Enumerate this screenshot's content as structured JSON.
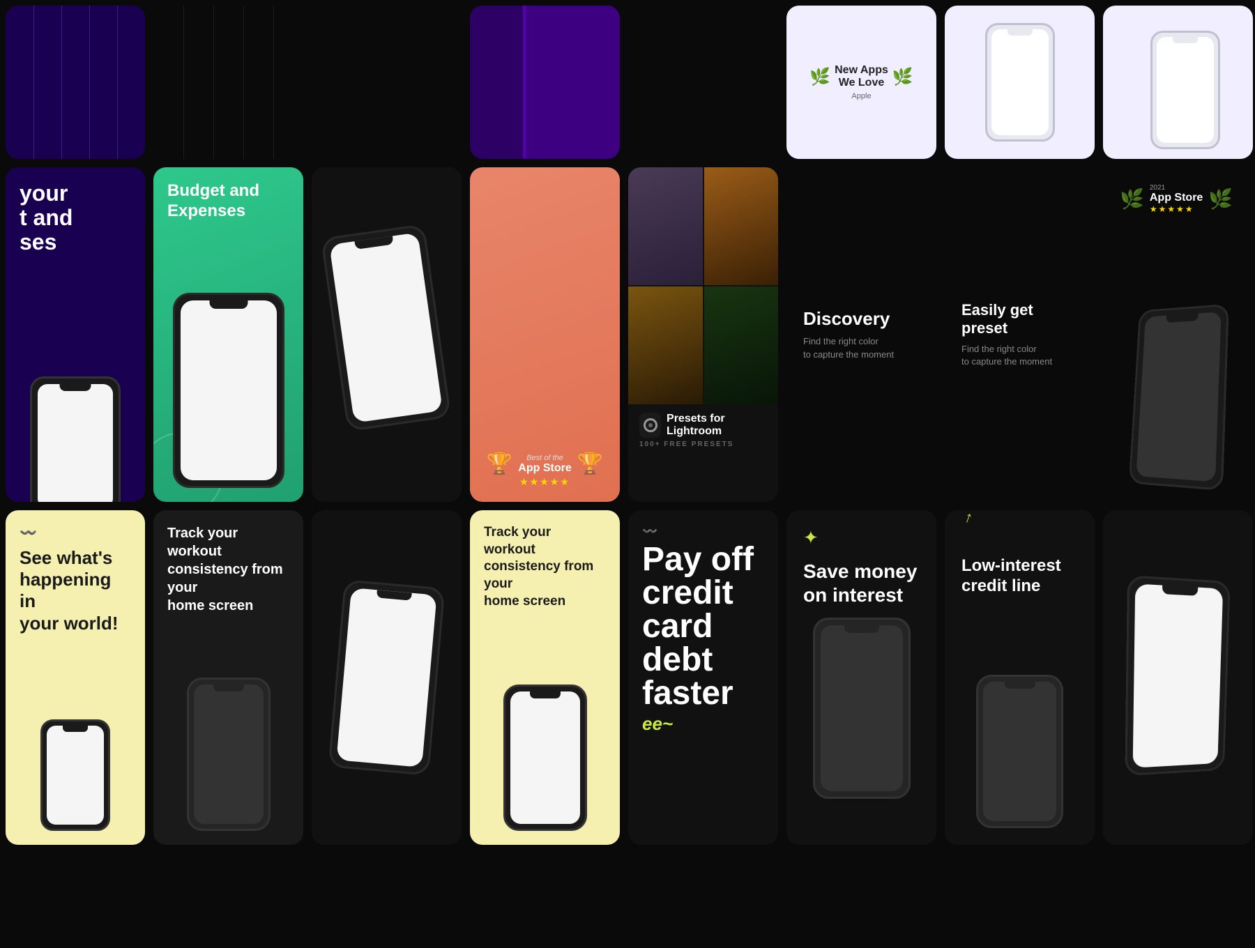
{
  "row1": {
    "c1": {
      "bg": "purple",
      "lines": true
    },
    "c4": {
      "type": "purple_phone"
    },
    "c5": {
      "type": "empty_dark"
    },
    "c6": {
      "badge": {
        "line1": "New Apps",
        "line2": "We Love",
        "sub": "Apple"
      }
    },
    "c7": {
      "type": "phone_light"
    },
    "c8": {
      "type": "phone_light_2"
    }
  },
  "row2": {
    "c1": {
      "title": "Budget and Expenses",
      "has_phone": true
    },
    "c2": {
      "title": "Budget and\nExpenses",
      "bg": "green"
    },
    "c3": {
      "has_phone": true
    },
    "c4": {
      "badge_line1": "Best of the",
      "badge_line2": "App Store",
      "stars": "★★★★★"
    },
    "c5": {
      "photo_grid": true,
      "app_name": "Presets for Lightroom",
      "app_sub": "100+ FREE PRESETS"
    },
    "c6": {
      "title": "Discovery",
      "subtitle": "Find the right color\nto capture the moment"
    },
    "c7": {
      "title": "Easily get preset",
      "subtitle": "Find the right color\nto capture the moment"
    },
    "c8": {
      "badge_year": "2021",
      "badge_name": "App Store",
      "stars": "★★★★★",
      "has_phone": true
    }
  },
  "row3": {
    "c1": {
      "icon": "wavy",
      "title": "See what's\nhappening in\nyour world!",
      "bg": "yellow"
    },
    "c2": {
      "title": "Track your workout\nconsistency from your\nhome screen",
      "has_phone": true
    },
    "c3": {
      "has_phone": true
    },
    "c4": {
      "title": "Track your workout\nconsistency from your\nhome screen",
      "bg": "yellow"
    },
    "c5": {
      "icon": "wavy",
      "payoff_label": "Pay off",
      "payoff_lines": [
        "credit",
        "card debt",
        "faster"
      ],
      "cursive": "ee"
    },
    "c6": {
      "sparkle": "✦",
      "title": "Save money\non interest"
    },
    "c7": {
      "arrow": "↑",
      "title": "Low-interest\ncredit line"
    },
    "c8": {
      "has_phone": true
    }
  },
  "partial_left": {
    "line1": "your",
    "line2": "t and",
    "line3": "ses"
  }
}
